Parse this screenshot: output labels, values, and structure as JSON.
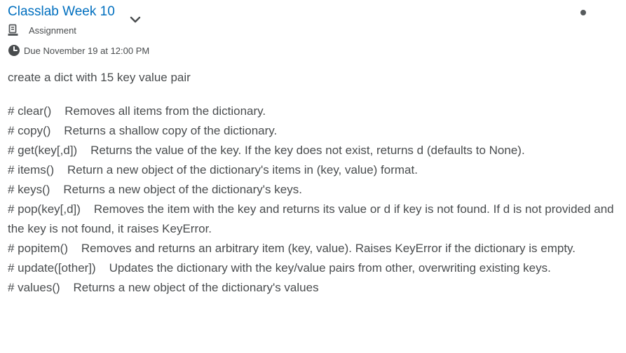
{
  "header": {
    "title": "Classlab Week 10",
    "type_label": "Assignment",
    "due_label": "Due November 19 at 12:00 PM"
  },
  "icons": {
    "expand": "chevron-down-icon",
    "assignment": "assignment-icon",
    "due": "clock-icon",
    "status": "unread-dot-icon"
  },
  "colors": {
    "link": "#006fbf",
    "text": "#494c4e",
    "icon": "#565a5c"
  },
  "instructions": {
    "intro": "create a dict with 15 key value pair",
    "lines": [
      "# clear()    Removes all items from the dictionary.",
      "# copy()    Returns a shallow copy of the dictionary.",
      "# get(key[,d])    Returns the value of the key. If the key does not exist, returns d (defaults to None).",
      "# items()    Return a new object of the dictionary's items in (key, value) format.",
      "# keys()    Returns a new object of the dictionary's keys.",
      "# pop(key[,d])    Removes the item with the key and returns its value or d if key is not found. If d is not provided and the key is not found, it raises KeyError.",
      "# popitem()    Removes and returns an arbitrary item (key, value). Raises KeyError if the dictionary is empty.",
      "# update([other])    Updates the dictionary with the key/value pairs from other, overwriting existing keys.",
      "# values()    Returns a new object of the dictionary's values"
    ]
  }
}
